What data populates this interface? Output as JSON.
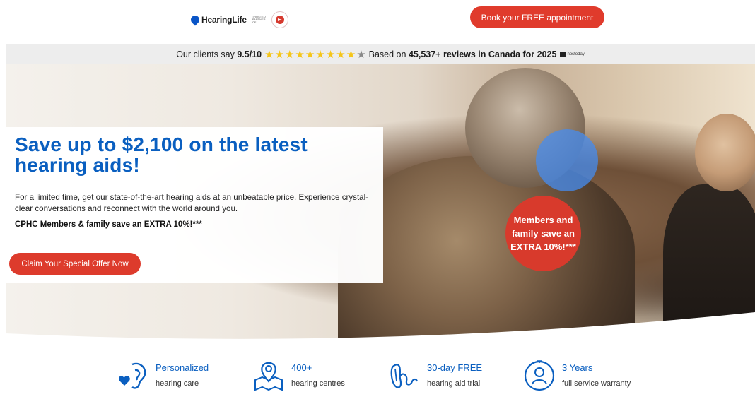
{
  "header": {
    "brand": "HearingLife",
    "partner_text": "TRUSTED PARTNER OF",
    "book_button": "Book your FREE appointment"
  },
  "rating": {
    "prefix": "Our clients say",
    "score": "9.5/10",
    "based_on": "Based on",
    "reviews": "45,537+ reviews in Canada for 2025",
    "source": "npstoday",
    "stars_filled": 9,
    "stars_total": 10
  },
  "hero": {
    "headline": "Save up to $2,100 on the latest hearing aids!",
    "description": "For a limited time, get our state-of-the-art hearing aids at an unbeatable price. Experience crystal-clear conversations and reconnect with the world around you.",
    "members_note": "CPHC Members & family save an EXTRA 10%!***",
    "cta": "Claim Your Special Offer Now",
    "badge": "Members and family save an EXTRA 10%!***"
  },
  "features": [
    {
      "icon": "ear-heart-icon",
      "title": "Personalized",
      "subtitle": "hearing care"
    },
    {
      "icon": "map-pin-icon",
      "title": "400+",
      "subtitle": "hearing centres"
    },
    {
      "icon": "hearing-aid-icon",
      "title": "30-day FREE",
      "subtitle": "hearing aid trial"
    },
    {
      "icon": "shield-person-icon",
      "title": "3 Years",
      "subtitle": "full service warranty"
    }
  ],
  "colors": {
    "brand_blue": "#0a5fc0",
    "cta_red": "#e03b2c",
    "star_yellow": "#f5c518"
  }
}
